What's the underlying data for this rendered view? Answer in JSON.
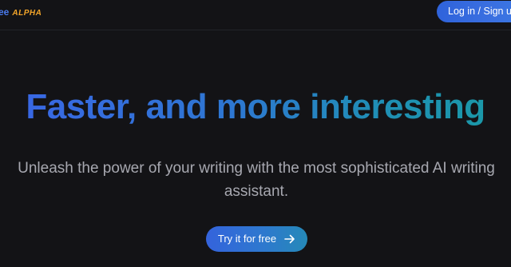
{
  "header": {
    "brand_name": "ee",
    "brand_badge": "ALPHA",
    "login_label": "Log in / Sign up"
  },
  "hero": {
    "title": "Faster, and more interesting",
    "subtitle": "Unleash the power of your writing with the most sophisticated AI writing assistant.",
    "cta_label": "Try it for free",
    "cta_icon": "arrow-right-icon"
  },
  "colors": {
    "background": "#131316",
    "accent_blue": "#3a66e6",
    "accent_teal": "#1a9aa6",
    "badge_orange": "#f2a52a",
    "subtitle_gray": "#a7a8b0"
  }
}
